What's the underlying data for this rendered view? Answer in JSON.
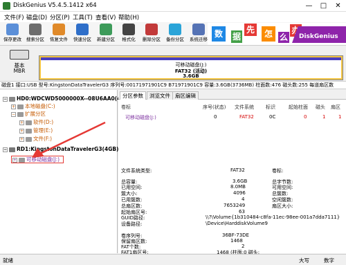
{
  "window": {
    "title": "DiskGenius V5.4.5.1412 x64",
    "minimize": "—",
    "maximize": "□",
    "close": "✕"
  },
  "menu": [
    "文件(F)",
    "磁盘(D)",
    "分区(P)",
    "工具(T)",
    "查看(V)",
    "帮助(H)"
  ],
  "toolbar": [
    {
      "label": "保存更改",
      "color": "#5b8fd8"
    },
    {
      "label": "搜索分区",
      "color": "#6d6d6d"
    },
    {
      "label": "恢复文件",
      "color": "#e08a2a"
    },
    {
      "label": "快速分区",
      "color": "#2f6fc9"
    },
    {
      "label": "新建分区",
      "color": "#3d9b5a"
    },
    {
      "label": "格式化",
      "color": "#444444"
    },
    {
      "label": "删除分区",
      "color": "#c23a3a"
    },
    {
      "label": "备份分区",
      "color": "#2aa4d8"
    },
    {
      "label": "系统迁移",
      "color": "#5573b5"
    }
  ],
  "banner": {
    "chars": [
      {
        "t": "数",
        "c": "#1e88e5"
      },
      {
        "t": "据",
        "c": "#43a047"
      },
      {
        "t": "先",
        "c": "#e53935"
      },
      {
        "t": "怎",
        "c": "#fb8c00"
      },
      {
        "t": "么",
        "c": "#8e24aa"
      },
      {
        "t": "办",
        "c": "#e53935"
      }
    ],
    "brand": "DiskGenius"
  },
  "disk_map": {
    "side_top": "基本",
    "side_bottom": "MBR",
    "name": "可移动磁盘(J:)",
    "fs": "FAT32 (活动)",
    "size": "3.6GB"
  },
  "info_bar": "磁盘1 接口:USB 型号:KingstonDataTravelerG3 序列号:00171971901C9 B71971901C9 容量:3.6GB(3736MB) 柱面数:476 磁头数:255 每道扇区数",
  "tree": {
    "hd0": "HD0:WDCWD5000000X--08U6AA0(46",
    "c": "本地磁盘(C:)",
    "ext": "扩展分区",
    "d": "软件(D:)",
    "e": "管理(E:)",
    "f": "文件(F:)",
    "rd1": "RD1:KingstonDataTravelerG3(4GB)",
    "j": "可移动磁盘(J:)"
  },
  "tabs": [
    "分区参数",
    "浏览文件",
    "扇区编辑"
  ],
  "table": {
    "headers": [
      "卷标",
      "序号(状态)",
      "文件系统",
      "标识",
      "起始柱面",
      "磁头",
      "扇区"
    ],
    "row": [
      "可移动磁盘(J:)",
      "0",
      "FAT32",
      "0C",
      "0",
      "1",
      "1"
    ]
  },
  "props": {
    "fs_type_label": "文件系统类型:",
    "fs_type": "FAT32",
    "vol_label_label": "卷标:",
    "total_label": "总容量:",
    "total": "3.6GB",
    "total_bytes_label": "总字节数:",
    "used_label": "已用空间:",
    "used": "8.0MB",
    "free_label": "可用空间:",
    "cluster_label": "簇大小:",
    "cluster": "4096",
    "total_clusters_label": "总簇数:",
    "used_clusters_label": "已用簇数:",
    "used_clusters": "4",
    "free_clusters_label": "空闲簇数:",
    "total_sectors_label": "总扇区数:",
    "total_sectors": "7653249",
    "sector_size_label": "扇区大小:",
    "start_sector_label": "起始扇区号:",
    "start_sector": "63",
    "guid_label": "GUID路径:",
    "guid": "\\\\?\\Volume{1b310484-c8fa-11ec-98ee-001a7dda7111}",
    "device_label": "设备路径:",
    "device": "\\Device\\HarddiskVolume9",
    "serial_label": "卷序列号:",
    "serial": "36BF-73DE",
    "reserved_label": "保留扇区数:",
    "reserved": "1468",
    "fat_count_label": "FAT个数:",
    "fat_count": "2",
    "fat1_label": "FAT1扇区号:",
    "fat1": "1468 (柱面:0 磁头:"
  },
  "status": {
    "left": "就绪",
    "caps": "大写",
    "num": "数字"
  }
}
